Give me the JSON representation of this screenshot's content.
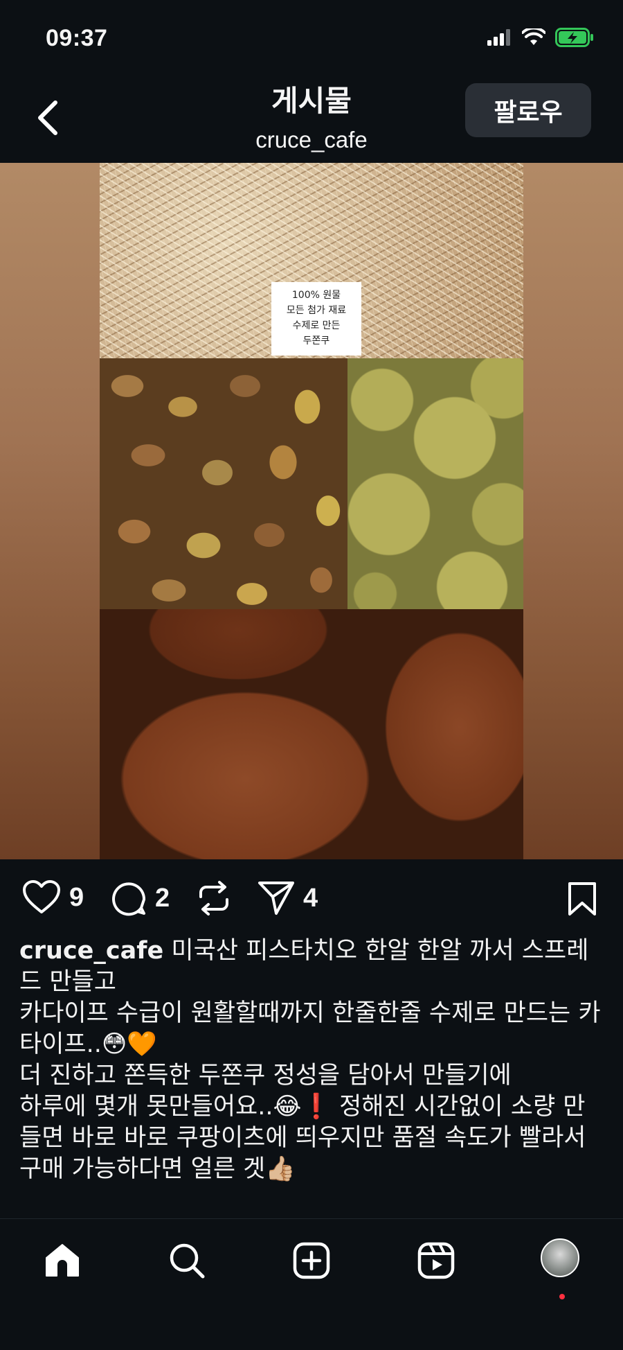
{
  "status_bar": {
    "time": "09:37",
    "icons": [
      "signal-icon",
      "wifi-icon",
      "battery-charging-icon"
    ],
    "battery_color": "#34c759"
  },
  "header": {
    "title": "게시물",
    "subtitle": "cruce_cafe",
    "follow_label": "팔로우",
    "back_icon": "chevron-left-icon"
  },
  "post": {
    "image_label_lines": [
      "100% 원물",
      "모든 첨가 재료",
      "수제로 만든",
      "두쫀쿠"
    ]
  },
  "actions": {
    "like_count": "9",
    "comment_count": "2",
    "share_count": "4",
    "icons": [
      "heart-icon",
      "comment-icon",
      "repost-icon",
      "send-icon",
      "bookmark-icon"
    ]
  },
  "caption": {
    "username": "cruce_cafe",
    "line1": " 미국산 피스타치오 한알 한알 까서 스프레드 만들고",
    "line2": "카다이프 수급이 원활할때까지 한줄한줄 수제로 만드는 카타이프..😳🧡",
    "line3": "더 진하고 쫀득한 두쫀쿠 정성을 담아서 만들기에",
    "line4": "하루에 몇개 못만들어요..😂❗️ 정해진 시간없이 소량 만들면 바로 바로 쿠팡이츠에 띄우지만 품절 속도가 빨라서 구매 가능하다면 얼른 겟👍🏼"
  },
  "bottom_nav": {
    "items": [
      "home-icon",
      "search-icon",
      "create-icon",
      "reels-icon",
      "profile-avatar"
    ],
    "notification_color": "#ff3040"
  },
  "colors": {
    "background": "#0c1014",
    "text": "#f5f5f5",
    "follow_button_bg": "#2a2f36"
  }
}
